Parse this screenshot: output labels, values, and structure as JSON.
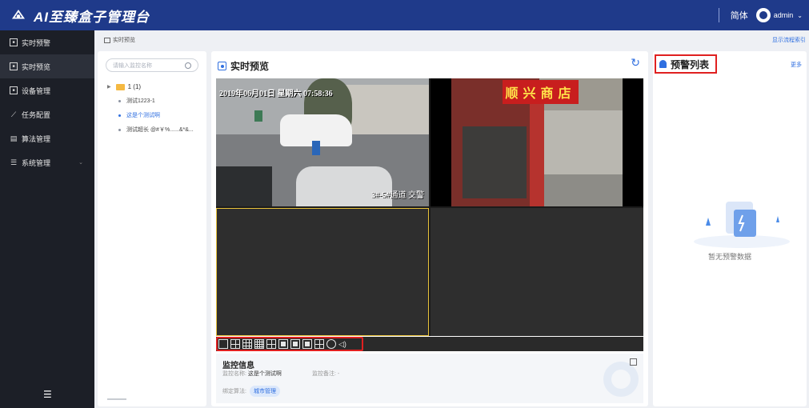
{
  "app": {
    "title": "AI至臻盒子管理台",
    "lang": "简体",
    "user": "admin"
  },
  "sidebar": {
    "items": [
      {
        "label": "实时预警",
        "icon": "monitor-icon"
      },
      {
        "label": "实时预览",
        "icon": "preview-icon"
      },
      {
        "label": "设备管理",
        "icon": "device-icon"
      },
      {
        "label": "任务配置",
        "icon": "chart-icon"
      },
      {
        "label": "算法管理",
        "icon": "algorithm-icon"
      },
      {
        "label": "系统管理",
        "icon": "settings-icon"
      }
    ],
    "active_index": 1
  },
  "breadcrumb": {
    "current": "实时预览",
    "guide_link": "显示流程索引"
  },
  "tree": {
    "search_placeholder": "请输入监控名称",
    "root": {
      "label": "1 (1)"
    },
    "children": [
      "测试1223-1",
      "这是个测试啊",
      "测试超长 @#￥%......&*&..."
    ],
    "active_index": 1
  },
  "preview": {
    "title": "实时预览",
    "cameras": [
      {
        "timestamp": "2019年06月01日 星期六 07:58:36",
        "label": "3#-5#通道 交警"
      },
      {
        "sign": "顺兴商店"
      },
      {},
      {}
    ],
    "toolbar": [
      "split-1-icon",
      "split-4-icon",
      "split-9-icon",
      "split-16-icon",
      "split-6-icon",
      "snapshot-icon",
      "record-icon",
      "window-icon",
      "fullscreen-icon",
      "ptz-icon",
      "volume-icon"
    ],
    "info": {
      "title": "监控信息",
      "name_label": "监控名称:",
      "name_value": "这是个测试啊",
      "remark_label": "监控备注:",
      "remark_value": "-",
      "algo_label": "绑定算法:",
      "algo_tag": "城市管理"
    }
  },
  "alerts": {
    "title": "预警列表",
    "more": "更多",
    "empty": "暂无预警数据"
  },
  "colors": {
    "topbar": "#1f3a8a",
    "sidebar": "#1c1f27",
    "accent": "#2f6fe0",
    "highlight": "#e02020"
  }
}
